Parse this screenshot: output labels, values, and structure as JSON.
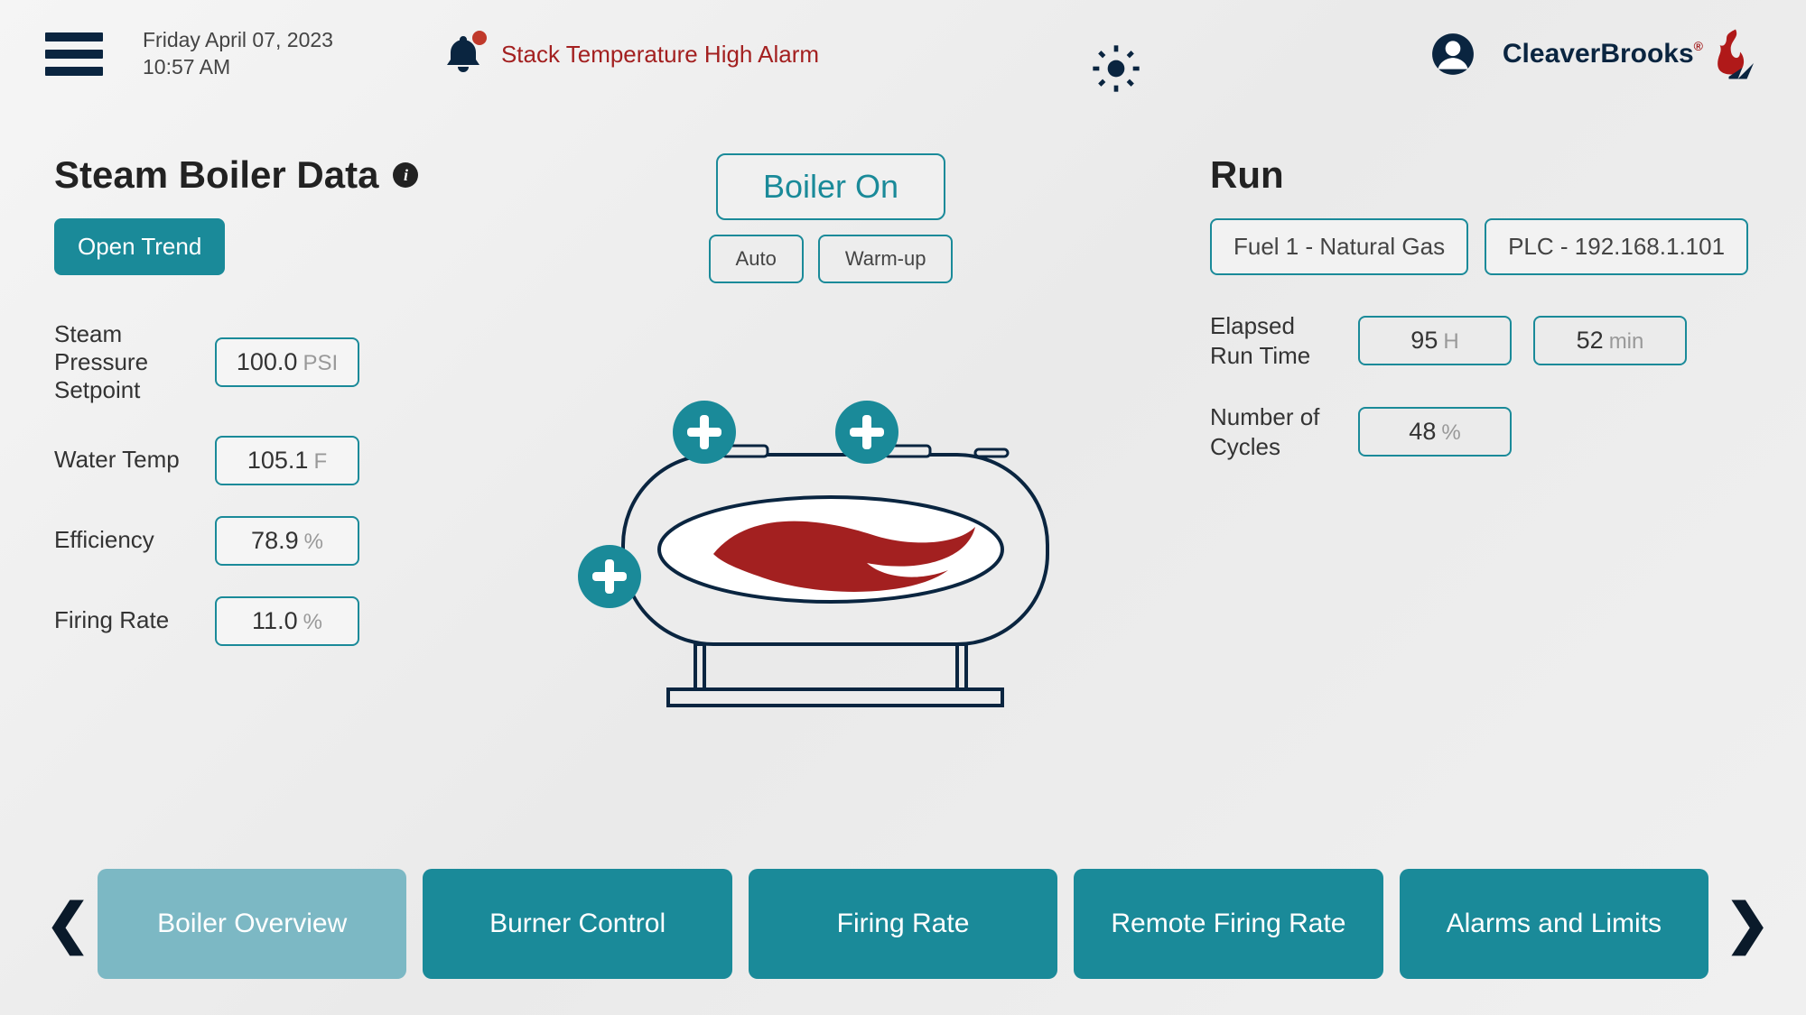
{
  "header": {
    "date": "Friday April 07, 2023",
    "time": "10:57 AM",
    "alarm_text": "Stack Temperature High Alarm",
    "brand_a": "Cleaver",
    "brand_b": "Brooks"
  },
  "left": {
    "title": "Steam Boiler Data",
    "open_trend": "Open Trend",
    "rows": {
      "steam_pressure": {
        "label": "Steam Pressure Setpoint",
        "value": "100.0",
        "unit": "PSI"
      },
      "water_temp": {
        "label": "Water Temp",
        "value": "105.1",
        "unit": "F"
      },
      "efficiency": {
        "label": "Efficiency",
        "value": "78.9",
        "unit": "%"
      },
      "firing_rate": {
        "label": "Firing Rate",
        "value": "11.0",
        "unit": "%"
      }
    }
  },
  "center": {
    "boiler_on": "Boiler On",
    "auto": "Auto",
    "warmup": "Warm-up"
  },
  "right": {
    "title": "Run",
    "fuel": "Fuel 1 - Natural Gas",
    "plc": "PLC - 192.168.1.101",
    "runtime_label": "Elapsed Run Time",
    "hours_value": "95",
    "hours_unit": "H",
    "mins_value": "52",
    "mins_unit": "min",
    "cycles_label": "Number of Cycles",
    "cycles_value": "48",
    "cycles_unit": "%"
  },
  "nav": {
    "items": [
      "Boiler Overview",
      "Burner Control",
      "Firing Rate",
      "Remote Firing Rate",
      "Alarms and Limits"
    ]
  }
}
